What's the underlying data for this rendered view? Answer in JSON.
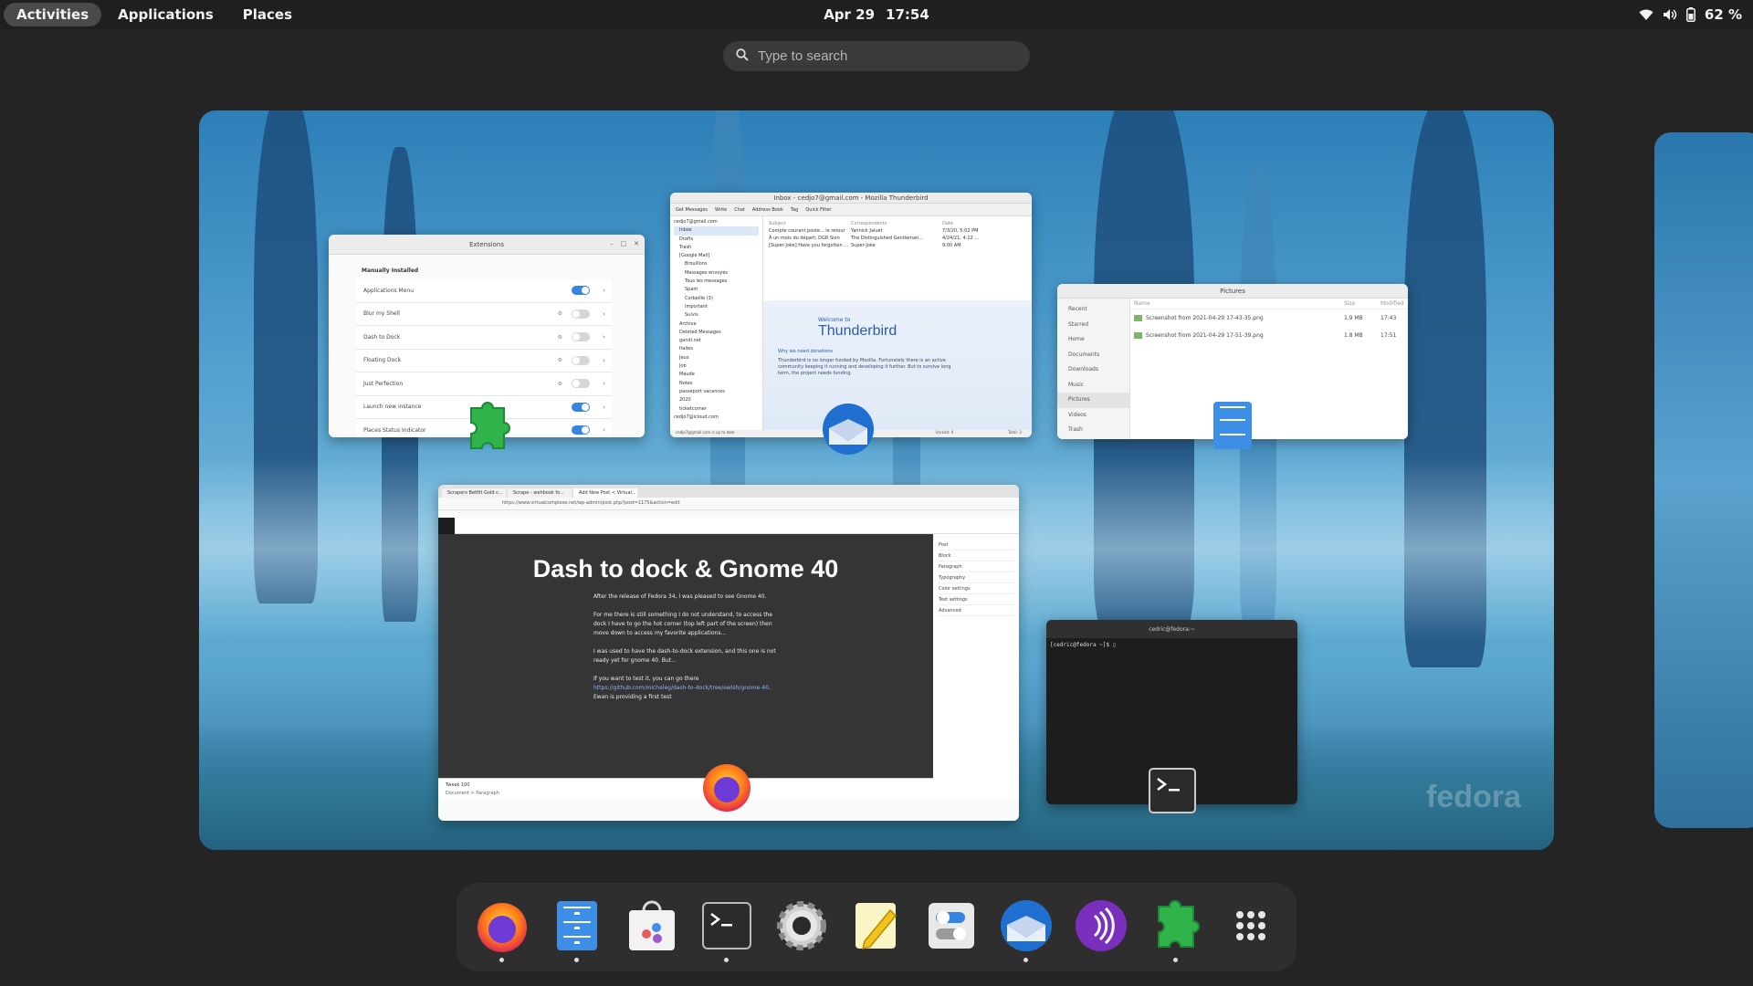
{
  "topbar": {
    "activities": "Activities",
    "applications": "Applications",
    "places": "Places",
    "date": "Apr 29",
    "time": "17:54",
    "battery": "62 %"
  },
  "search": {
    "placeholder": "Type to search"
  },
  "windows": {
    "extensions": {
      "title": "Extensions",
      "section": "Manually Installed",
      "rows": [
        {
          "name": "Applications Menu",
          "on": true
        },
        {
          "name": "Blur my Shell",
          "on": false
        },
        {
          "name": "Dash to Dock",
          "on": false
        },
        {
          "name": "Floating Dock",
          "on": false
        },
        {
          "name": "Just Perfection",
          "on": false
        },
        {
          "name": "Launch new instance",
          "on": true
        },
        {
          "name": "Places Status Indicator",
          "on": true
        }
      ]
    },
    "thunderbird": {
      "title": "Inbox - cedjo7@gmail.com - Mozilla Thunderbird",
      "menu": [
        "Get Messages",
        "Write",
        "Chat",
        "Address Book",
        "Tag",
        "Quick Filter"
      ],
      "folders": [
        "cedjo7@gmail.com",
        "Inbox",
        "Drafts",
        "Trash",
        "[Google Mail]",
        "Brouillons",
        "Messages envoyés",
        "Tous les messages",
        "Spam",
        "Corbeille (3)",
        "Important",
        "Suivis",
        "Archive",
        "Deleted Messages",
        "gandi.net",
        "Italies",
        "Jeux",
        "Job",
        "Maude",
        "Notes",
        "passeport vacances",
        "2020",
        "ticketcorner",
        "cedjo7@icloud.com"
      ],
      "columns": [
        "Subject",
        "Correspondents",
        "Date"
      ],
      "messages": [
        {
          "subject": "Compte courant poste... le retour",
          "from": "Yannick Jaluet",
          "date": "7/3/20, 5:02 PM"
        },
        {
          "subject": "À un mois du départ; DGR Sion",
          "from": "The Distinguished Gentleman...",
          "date": "4/24/21, 4:12 ..."
        },
        {
          "subject": "[Super-Joke] Have you forgotten ...",
          "from": "Super-Joke",
          "date": "9:00 AM"
        }
      ],
      "welcome_small": "Welcome to",
      "welcome_big": "Thunderbird",
      "welcome_heading": "Why we need donations",
      "welcome_text": "Thunderbird is no longer funded by Mozilla. Fortunately there is an active community keeping it running and developing it further. But to survive long term, the project needs funding.",
      "status": "cedjo7@gmail.com is up to date",
      "unread": "Unread: 0",
      "total": "Total: 3"
    },
    "files": {
      "title": "Pictures",
      "sidebar": [
        "Recent",
        "Starred",
        "Home",
        "Documents",
        "Downloads",
        "Music",
        "Pictures",
        "Videos",
        "Trash"
      ],
      "columns": [
        "Name",
        "Size",
        "Modified"
      ],
      "rows": [
        {
          "name": "Screenshot from 2021-04-29 17-43-35.png",
          "size": "1.9 MB",
          "modified": "17:43"
        },
        {
          "name": "Screenshot from 2021-04-29 17-51-39.png",
          "size": "1.8 MB",
          "modified": "17:51"
        }
      ]
    },
    "firefox": {
      "tabs": [
        "Scrapers Betfilt Gold c...",
        "Scrape - wehbook fo...",
        "Add New Post < Virtual..."
      ],
      "url": "https://www.virtualcomplexe.net/wp-admin/post.php?post=1175&action=edit",
      "post_title": "Dash to dock & Gnome 40",
      "paragraphs": [
        "After the release of Fedora 34, I was pleased to see Gnome 40.",
        "For me there is still something I do not understand, to access the dock I have to go the hot corner (top left part of the screen) then move down to access my favorite applications...",
        "I was used to have the dash-to-dock extension, and this one is not ready yet for gnome 40. But...",
        "If you want to test it, you can go there"
      ],
      "link": "https://github.com/micheleg/dash-to-dock/tree/ewlsh/gnome-40",
      "after_link": ". Ewan is providing a first test",
      "footer_input": "Tweak 100",
      "breadcrumb": "Document  >  Paragraph",
      "panel": [
        "Post",
        "Block",
        "Paragraph",
        "Typography",
        "Color settings",
        "Text settings",
        "Advanced"
      ]
    },
    "terminal": {
      "title": "cedric@fedora:~",
      "prompt": "[cedric@fedora ~]$ "
    }
  },
  "wallpaper": {
    "brand": "fedora"
  },
  "dock": {
    "items": [
      {
        "name": "firefox-icon",
        "running": true
      },
      {
        "name": "files-icon",
        "running": true
      },
      {
        "name": "software-icon",
        "running": false
      },
      {
        "name": "terminal-icon",
        "running": true
      },
      {
        "name": "settings-icon",
        "running": false
      },
      {
        "name": "text-editor-icon",
        "running": false
      },
      {
        "name": "tweaks-icon",
        "running": false
      },
      {
        "name": "thunderbird-icon",
        "running": true
      },
      {
        "name": "podcasts-icon",
        "running": false
      },
      {
        "name": "extensions-icon",
        "running": true
      },
      {
        "name": "show-apps-icon",
        "running": false
      }
    ]
  },
  "colors": {
    "accent": "#3584e4",
    "topbar": "#1f1f1f",
    "dock": "#2e2e2e"
  }
}
